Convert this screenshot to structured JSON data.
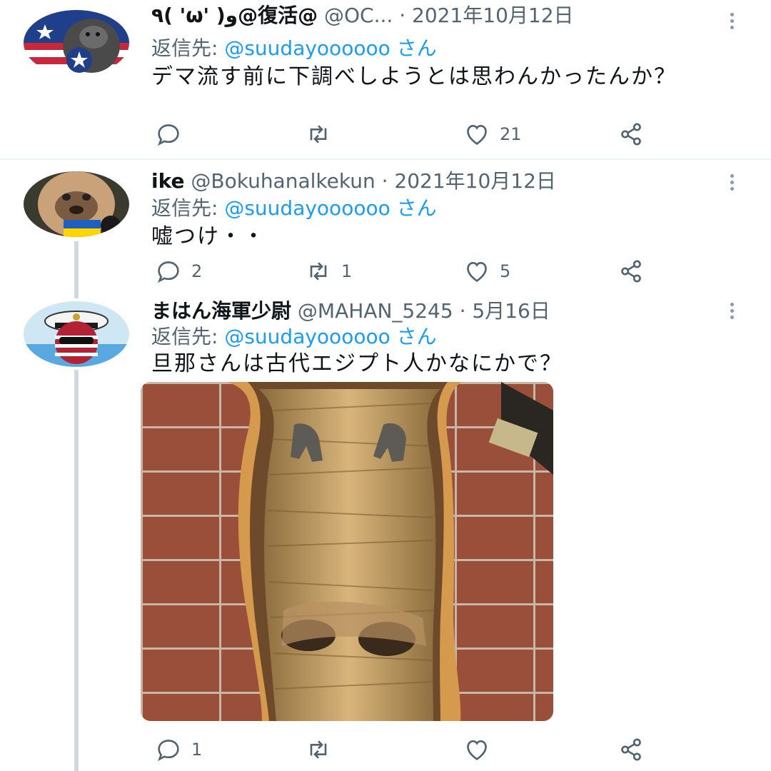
{
  "tweets": [
    {
      "name": "٩( 'ω' )و@復活@",
      "handle": "@OC...",
      "date": "· 2021年10月12日",
      "reply_label": "返信先: ",
      "reply_to": "@suudayoooooo さん",
      "text": "デマ流す前に下調べしようとは思わんかったんか？",
      "avatar_icon": "gorilla-captain-america-avatar",
      "counts": {
        "reply": "",
        "retweet": "",
        "like": "21"
      }
    },
    {
      "name": "ike",
      "handle": "@Bokuhanalkekun",
      "date": "· 2021年10月12日",
      "reply_label": "返信先: ",
      "reply_to": "@suudayoooooo さん",
      "text": "嘘つけ・・",
      "avatar_icon": "pug-ukraine-flag-avatar",
      "counts": {
        "reply": "2",
        "retweet": "1",
        "like": "5"
      }
    },
    {
      "name": "まはん海軍少尉",
      "handle": "@MAHAN_5245",
      "date": "· 5月16日",
      "reply_label": "返信先: ",
      "reply_to": "@suudayoooooo さん",
      "text": "旦那さんは古代エジプト人かなにかで？",
      "avatar_icon": "navy-officer-ball-avatar",
      "media": "mummy-in-coffin-photo",
      "counts": {
        "reply": "1",
        "retweet": "",
        "like": ""
      }
    }
  ],
  "colors": {
    "accent": "#1d9bf0",
    "muted": "#536471",
    "line": "#cfd9de"
  }
}
